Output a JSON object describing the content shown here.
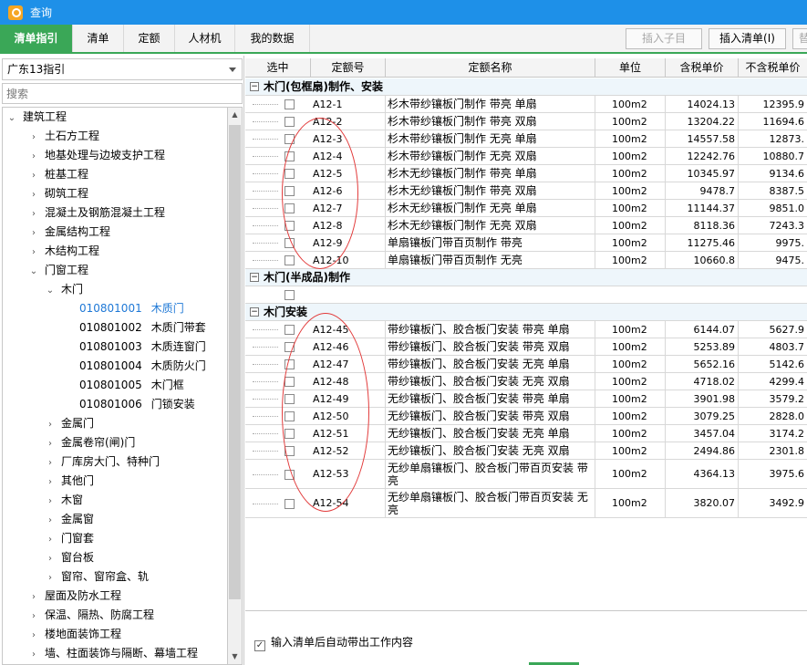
{
  "window": {
    "title": "查询"
  },
  "tabs": [
    {
      "label": "清单指引",
      "active": true
    },
    {
      "label": "清单"
    },
    {
      "label": "定额"
    },
    {
      "label": "人材机"
    },
    {
      "label": "我的数据"
    }
  ],
  "toolbar": {
    "insert_child": "插入子目",
    "insert_list": "插入清单(I)",
    "replace_partial": "替"
  },
  "left": {
    "guide_selected": "广东13指引",
    "search_placeholder": "搜索",
    "tree": [
      {
        "label": "建筑工程",
        "level": 0,
        "state": "expanded"
      },
      {
        "label": "土石方工程",
        "level": 1,
        "state": "collapsed"
      },
      {
        "label": "地基处理与边坡支护工程",
        "level": 1,
        "state": "collapsed"
      },
      {
        "label": "桩基工程",
        "level": 1,
        "state": "collapsed"
      },
      {
        "label": "砌筑工程",
        "level": 1,
        "state": "collapsed"
      },
      {
        "label": "混凝土及钢筋混凝土工程",
        "level": 1,
        "state": "collapsed"
      },
      {
        "label": "金属结构工程",
        "level": 1,
        "state": "collapsed"
      },
      {
        "label": "木结构工程",
        "level": 1,
        "state": "collapsed"
      },
      {
        "label": "门窗工程",
        "level": 1,
        "state": "expanded"
      },
      {
        "label": "木门",
        "level": 2,
        "state": "expanded"
      },
      {
        "code": "010801001",
        "label": "木质门",
        "level": 3,
        "selected": true
      },
      {
        "code": "010801002",
        "label": "木质门带套",
        "level": 3
      },
      {
        "code": "010801003",
        "label": "木质连窗门",
        "level": 3
      },
      {
        "code": "010801004",
        "label": "木质防火门",
        "level": 3
      },
      {
        "code": "010801005",
        "label": "木门框",
        "level": 3
      },
      {
        "code": "010801006",
        "label": "门锁安装",
        "level": 3
      },
      {
        "label": "金属门",
        "level": 2,
        "state": "collapsed"
      },
      {
        "label": "金属卷帘(闸)门",
        "level": 2,
        "state": "collapsed"
      },
      {
        "label": "厂库房大门、特种门",
        "level": 2,
        "state": "collapsed"
      },
      {
        "label": "其他门",
        "level": 2,
        "state": "collapsed"
      },
      {
        "label": "木窗",
        "level": 2,
        "state": "collapsed"
      },
      {
        "label": "金属窗",
        "level": 2,
        "state": "collapsed"
      },
      {
        "label": "门窗套",
        "level": 2,
        "state": "collapsed"
      },
      {
        "label": "窗台板",
        "level": 2,
        "state": "collapsed"
      },
      {
        "label": "窗帘、窗帘盒、轨",
        "level": 2,
        "state": "collapsed"
      },
      {
        "label": "屋面及防水工程",
        "level": 1,
        "state": "collapsed"
      },
      {
        "label": "保温、隔热、防腐工程",
        "level": 1,
        "state": "collapsed"
      },
      {
        "label": "楼地面装饰工程",
        "level": 1,
        "state": "collapsed"
      },
      {
        "label": "墙、柱面装饰与隔断、幕墙工程",
        "level": 1,
        "state": "collapsed"
      }
    ]
  },
  "grid": {
    "columns": [
      "选中",
      "定额号",
      "定额名称",
      "单位",
      "含税单价",
      "不含税单价"
    ],
    "groups": [
      {
        "title": "木门(包框扇)制作、安装",
        "rows": [
          {
            "code": "A12-1",
            "name": "杉木带纱镶板门制作 带亮 单扇",
            "unit": "100m2",
            "tax": "14024.13",
            "notax": "12395.9"
          },
          {
            "code": "A12-2",
            "name": "杉木带纱镶板门制作 带亮 双扇",
            "unit": "100m2",
            "tax": "13204.22",
            "notax": "11694.6"
          },
          {
            "code": "A12-3",
            "name": "杉木带纱镶板门制作 无亮 单扇",
            "unit": "100m2",
            "tax": "14557.58",
            "notax": "12873."
          },
          {
            "code": "A12-4",
            "name": "杉木带纱镶板门制作 无亮 双扇",
            "unit": "100m2",
            "tax": "12242.76",
            "notax": "10880.7"
          },
          {
            "code": "A12-5",
            "name": "杉木无纱镶板门制作 带亮 单扇",
            "unit": "100m2",
            "tax": "10345.97",
            "notax": "9134.6"
          },
          {
            "code": "A12-6",
            "name": "杉木无纱镶板门制作 带亮 双扇",
            "unit": "100m2",
            "tax": "9478.7",
            "notax": "8387.5"
          },
          {
            "code": "A12-7",
            "name": "杉木无纱镶板门制作 无亮 单扇",
            "unit": "100m2",
            "tax": "11144.37",
            "notax": "9851.0"
          },
          {
            "code": "A12-8",
            "name": "杉木无纱镶板门制作 无亮 双扇",
            "unit": "100m2",
            "tax": "8118.36",
            "notax": "7243.3"
          },
          {
            "code": "A12-9",
            "name": "单扇镶板门带百页制作 带亮",
            "unit": "100m2",
            "tax": "11275.46",
            "notax": "9975."
          },
          {
            "code": "A12-10",
            "name": "单扇镶板门带百页制作 无亮",
            "unit": "100m2",
            "tax": "10660.8",
            "notax": "9475."
          }
        ]
      },
      {
        "title": "木门(半成品)制作",
        "rows": []
      },
      {
        "title": "木门安装",
        "rows": [
          {
            "code": "A12-45",
            "name": "带纱镶板门、胶合板门安装 带亮 单扇",
            "unit": "100m2",
            "tax": "6144.07",
            "notax": "5627.9"
          },
          {
            "code": "A12-46",
            "name": "带纱镶板门、胶合板门安装 带亮 双扇",
            "unit": "100m2",
            "tax": "5253.89",
            "notax": "4803.7"
          },
          {
            "code": "A12-47",
            "name": "带纱镶板门、胶合板门安装 无亮 单扇",
            "unit": "100m2",
            "tax": "5652.16",
            "notax": "5142.6"
          },
          {
            "code": "A12-48",
            "name": "带纱镶板门、胶合板门安装 无亮 双扇",
            "unit": "100m2",
            "tax": "4718.02",
            "notax": "4299.4"
          },
          {
            "code": "A12-49",
            "name": "无纱镶板门、胶合板门安装 带亮 单扇",
            "unit": "100m2",
            "tax": "3901.98",
            "notax": "3579.2"
          },
          {
            "code": "A12-50",
            "name": "无纱镶板门、胶合板门安装 带亮 双扇",
            "unit": "100m2",
            "tax": "3079.25",
            "notax": "2828.0"
          },
          {
            "code": "A12-51",
            "name": "无纱镶板门、胶合板门安装 无亮 单扇",
            "unit": "100m2",
            "tax": "3457.04",
            "notax": "3174.2"
          },
          {
            "code": "A12-52",
            "name": "无纱镶板门、胶合板门安装 无亮 双扇",
            "unit": "100m2",
            "tax": "2494.86",
            "notax": "2301.8"
          },
          {
            "code": "A12-53",
            "name": "无纱单扇镶板门、胶合板门带百页安装 带亮",
            "unit": "100m2",
            "tax": "4364.13",
            "notax": "3975.6"
          },
          {
            "code": "A12-54",
            "name": "无纱单扇镶板门、胶合板门带百页安装 无亮",
            "unit": "100m2",
            "tax": "3820.07",
            "notax": "3492.9"
          }
        ]
      }
    ]
  },
  "options": {
    "auto_bring_work": "输入清单后自动带出工作内容",
    "auto_bring_work_checked": true
  },
  "colors": {
    "title_bar": "#1e90e8",
    "active_tab": "#3aa757",
    "selected_tree_text": "#1e78d6",
    "annotation_circle": "#e23b3b"
  }
}
